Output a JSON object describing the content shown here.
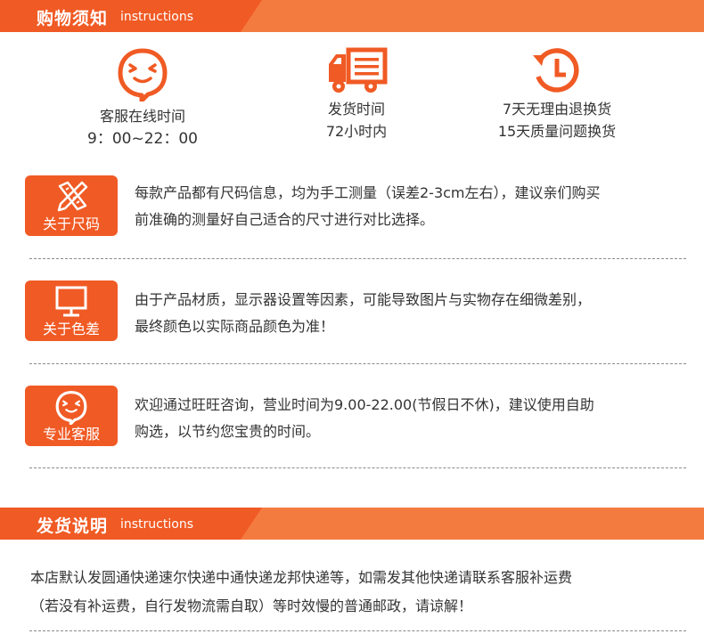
{
  "header1": {
    "title": "购物须知",
    "subtitle": "instructions"
  },
  "features": [
    {
      "icon": "chat-bubble-icon",
      "line1": "客服在线时间",
      "line2": "9：00~22：00"
    },
    {
      "icon": "delivery-truck-icon",
      "line1": "发货时间",
      "line2": "72小时内"
    },
    {
      "icon": "return-clock-icon",
      "line1": "7天无理由退换货",
      "line2": "15天质量问题换货"
    }
  ],
  "notes": [
    {
      "icon": "pencil-ruler-icon",
      "label": "关于尺码",
      "line1": "每款产品都有尺码信息，均为手工测量（误差2-3cm左右），建议亲们购买",
      "line2": "前准确的测量好自己适合的尺寸进行对比选择。"
    },
    {
      "icon": "monitor-icon",
      "label": "关于色差",
      "line1": "由于产品材质，显示器设置等因素，可能导致图片与实物存在细微差别，",
      "line2": "最终颜色以实际商品颜色为准！"
    },
    {
      "icon": "chat-bubble-icon",
      "label": "专业客服",
      "line1": "欢迎通过旺旺咨询，营业时间为9.00-22.00(节假日不休)，建议使用自助",
      "line2": "购选，以节约您宝贵的时间。"
    }
  ],
  "header2": {
    "title": "发货说明",
    "subtitle": "instructions"
  },
  "shipping": {
    "line1": "本店默认发圆通快递速尔快递中通快递龙邦快递等，如需发其他快递请联系客服补运费",
    "line2": "（若没有补运费，自行发物流需自取）等时效慢的普通邮政，请谅解！"
  },
  "colors": {
    "accent": "#f05a24",
    "bar": "#f47b40",
    "text": "#333333"
  }
}
